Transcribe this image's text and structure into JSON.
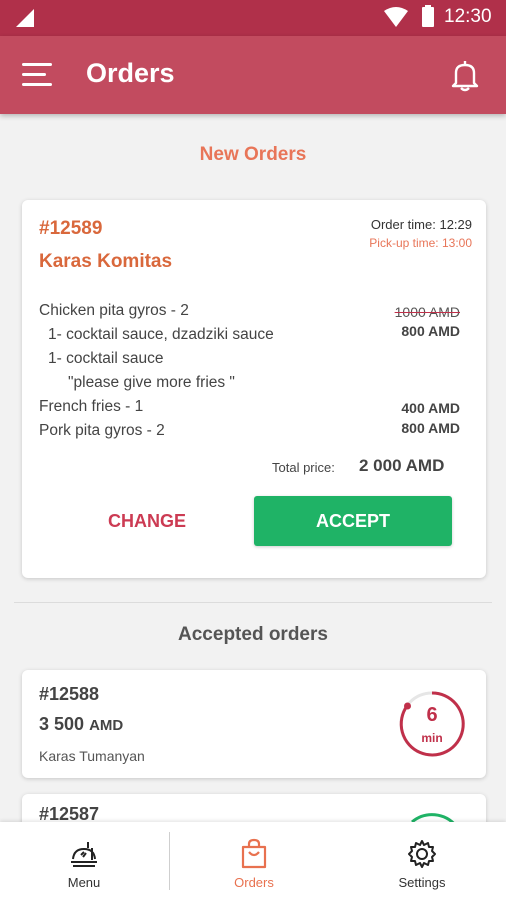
{
  "status_bar": {
    "time": "12:30"
  },
  "app_bar": {
    "title": "Orders"
  },
  "new_orders": {
    "heading": "New Orders",
    "order": {
      "id": "#12589",
      "customer": "Karas Komitas",
      "order_time": "Order time: 12:29",
      "pickup_time": "Pick-up time: 13:00",
      "lines": [
        {
          "text": "Chicken pita gyros - 2",
          "old_price": "1000 AMD",
          "price": "800 AMD"
        },
        {
          "text": "1- cocktail sauce, dzadziki sauce"
        },
        {
          "text": "1- cocktail sauce"
        },
        {
          "text": "\"please give more fries  \""
        },
        {
          "text": "French fries - 1",
          "price": "400 AMD"
        },
        {
          "text": "Pork pita gyros - 2",
          "price": "800 AMD"
        }
      ],
      "total_label": "Total price:",
      "total_value": "2 000 AMD",
      "change_label": "CHANGE",
      "accept_label": "ACCEPT"
    }
  },
  "accepted_orders": {
    "heading": "Accepted orders",
    "orders": [
      {
        "id": "#12588",
        "price": "3 500",
        "currency": "AMD",
        "customer": "Karas Tumanyan",
        "timer_value": "6",
        "timer_unit": "min",
        "timer_color": "#c0304a"
      },
      {
        "id": "#12587",
        "timer_color": "#1fb366"
      }
    ]
  },
  "bottom_nav": {
    "items": [
      {
        "label": "Menu",
        "icon": "menu-food-icon"
      },
      {
        "label": "Orders",
        "icon": "shopping-bag-icon",
        "active": true
      },
      {
        "label": "Settings",
        "icon": "gear-icon"
      }
    ]
  },
  "colors": {
    "status_bar": "#b0304a",
    "app_bar": "#c24b5f",
    "accent_orange": "#e87558",
    "accept_green": "#1fb366",
    "change_red": "#cc3b53"
  }
}
